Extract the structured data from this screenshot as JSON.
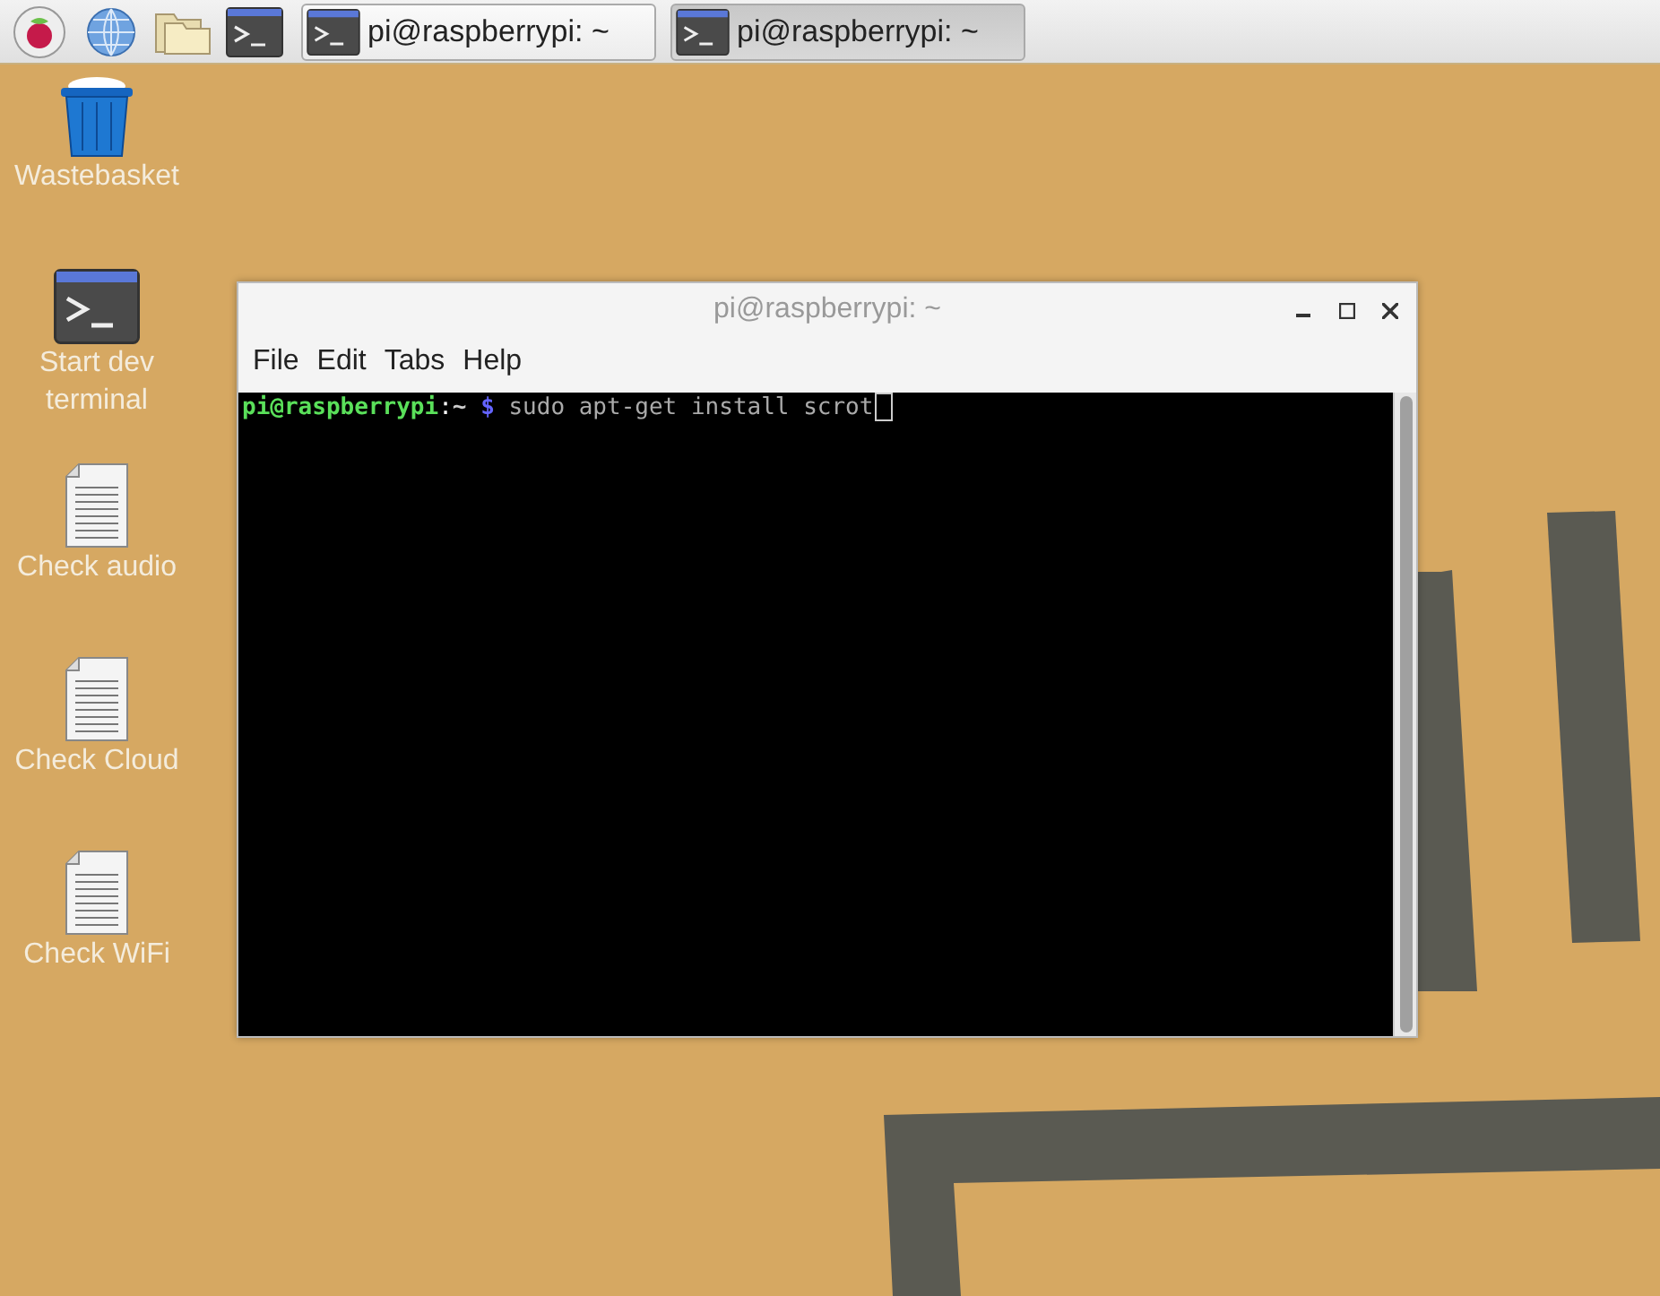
{
  "taskbar": {
    "launchers": [
      {
        "kind": "raspberry"
      },
      {
        "kind": "globe"
      },
      {
        "kind": "folder"
      },
      {
        "kind": "terminal"
      }
    ],
    "tasks": [
      {
        "label": "pi@raspberrypi: ~",
        "selected": false
      },
      {
        "label": "pi@raspberrypi: ~",
        "selected": true
      }
    ]
  },
  "desktop_icons": [
    {
      "kind": "trash",
      "label": "Wastebasket"
    },
    {
      "kind": "terminal",
      "label": "Start dev terminal"
    },
    {
      "kind": "document",
      "label": "Check audio"
    },
    {
      "kind": "document",
      "label": "Check Cloud"
    },
    {
      "kind": "document",
      "label": "Check WiFi"
    }
  ],
  "terminal_window": {
    "title": "pi@raspberrypi: ~",
    "menu": [
      "File",
      "Edit",
      "Tabs",
      "Help"
    ],
    "line": {
      "user": "pi@raspberrypi",
      "colon": ":",
      "path": "~",
      "dollar": "$",
      "command": "sudo apt-get install scrot"
    }
  }
}
